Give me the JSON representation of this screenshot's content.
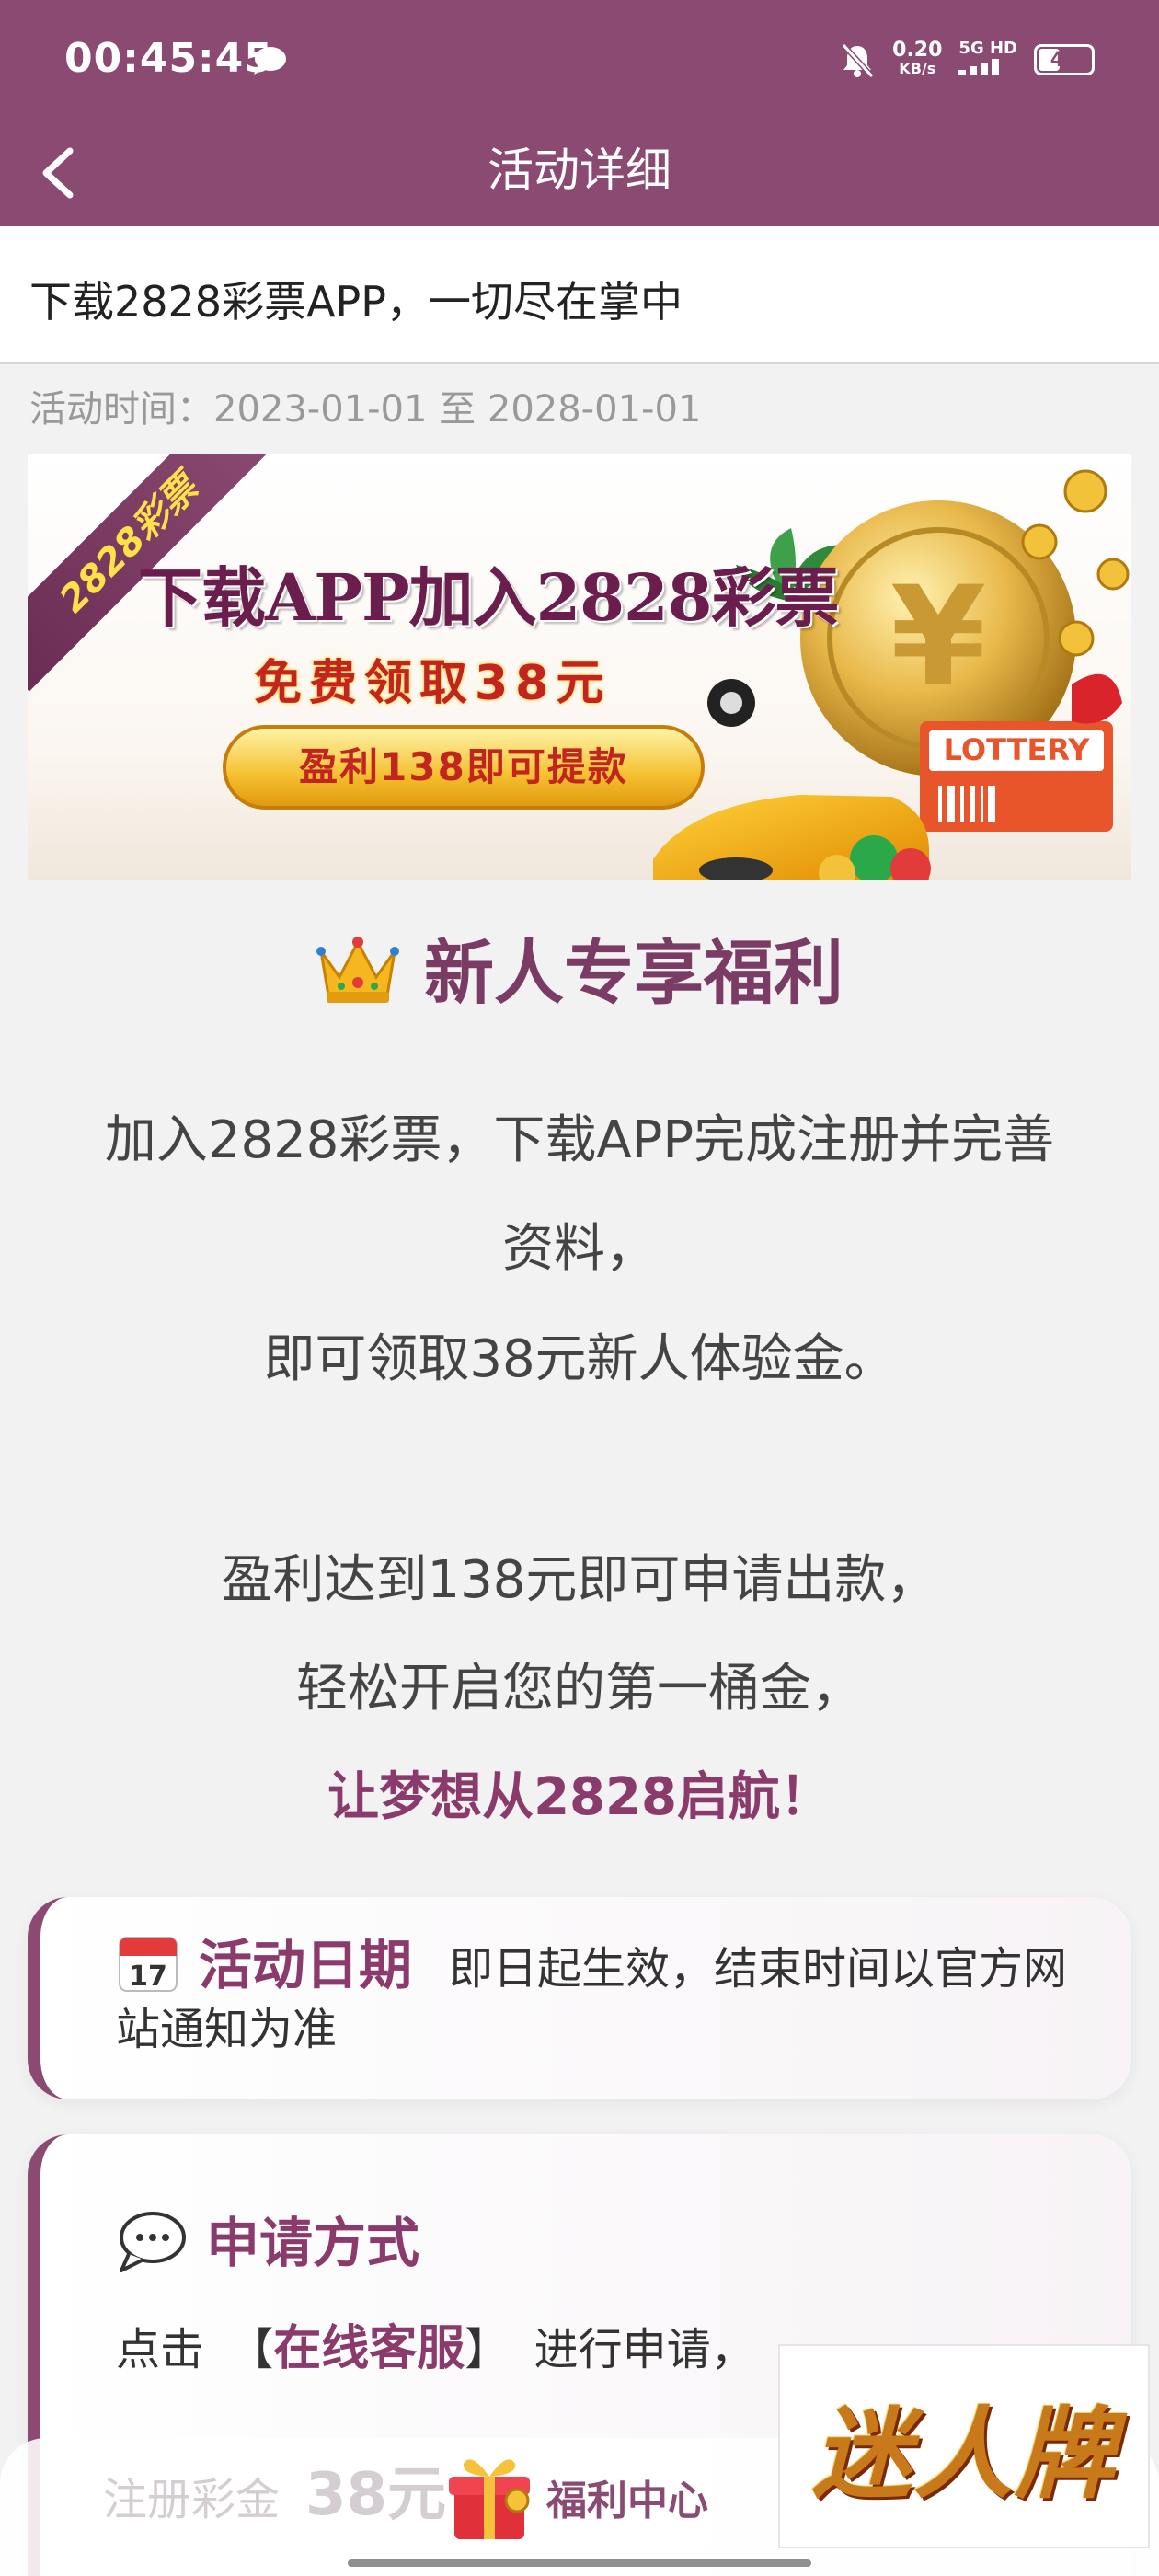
{
  "status_bar": {
    "time": "00:45:45",
    "net_speed_value": "0.20",
    "net_speed_unit": "KB/s",
    "signal_label": "5G HD",
    "battery": "45"
  },
  "nav": {
    "title": "活动详细"
  },
  "page": {
    "title": "下载2828彩票APP，一切尽在掌中",
    "activity_time": "活动时间：2023-01-01 至 2028-01-01"
  },
  "banner": {
    "ribbon": "2828彩票",
    "headline": "下载APP加入2828彩票",
    "sub": "免费领取38元",
    "pill": "盈利138即可提款",
    "lottery_label": "LOTTERY"
  },
  "section": {
    "heading": "新人专享福利"
  },
  "description": {
    "line1": "加入2828彩票，下载APP完成注册并完善",
    "line2": "资料，",
    "line3": "即可领取38元新人体验金。",
    "line4": "盈利达到138元即可申请出款，",
    "line5": "轻松开启您的第一桶金，",
    "line6": "让梦想从2828启航！"
  },
  "card_date": {
    "title": "活动日期",
    "text": "即日起生效，结束时间以官方网站通知为准"
  },
  "card_apply": {
    "title": "申请方式",
    "prefix": "点击",
    "bracket_open": "【",
    "link": "在线客服",
    "bracket_close": "】",
    "suffix": "进行申请，"
  },
  "bottom": {
    "faded_label": "注册彩金",
    "faded_amount": "38元",
    "welfare_label": "福利中心",
    "brand_watermark": "迷人牌"
  },
  "colors": {
    "primary": "#8b4a72",
    "accent_text": "#8b3a6c",
    "background": "#f3f2f3"
  }
}
